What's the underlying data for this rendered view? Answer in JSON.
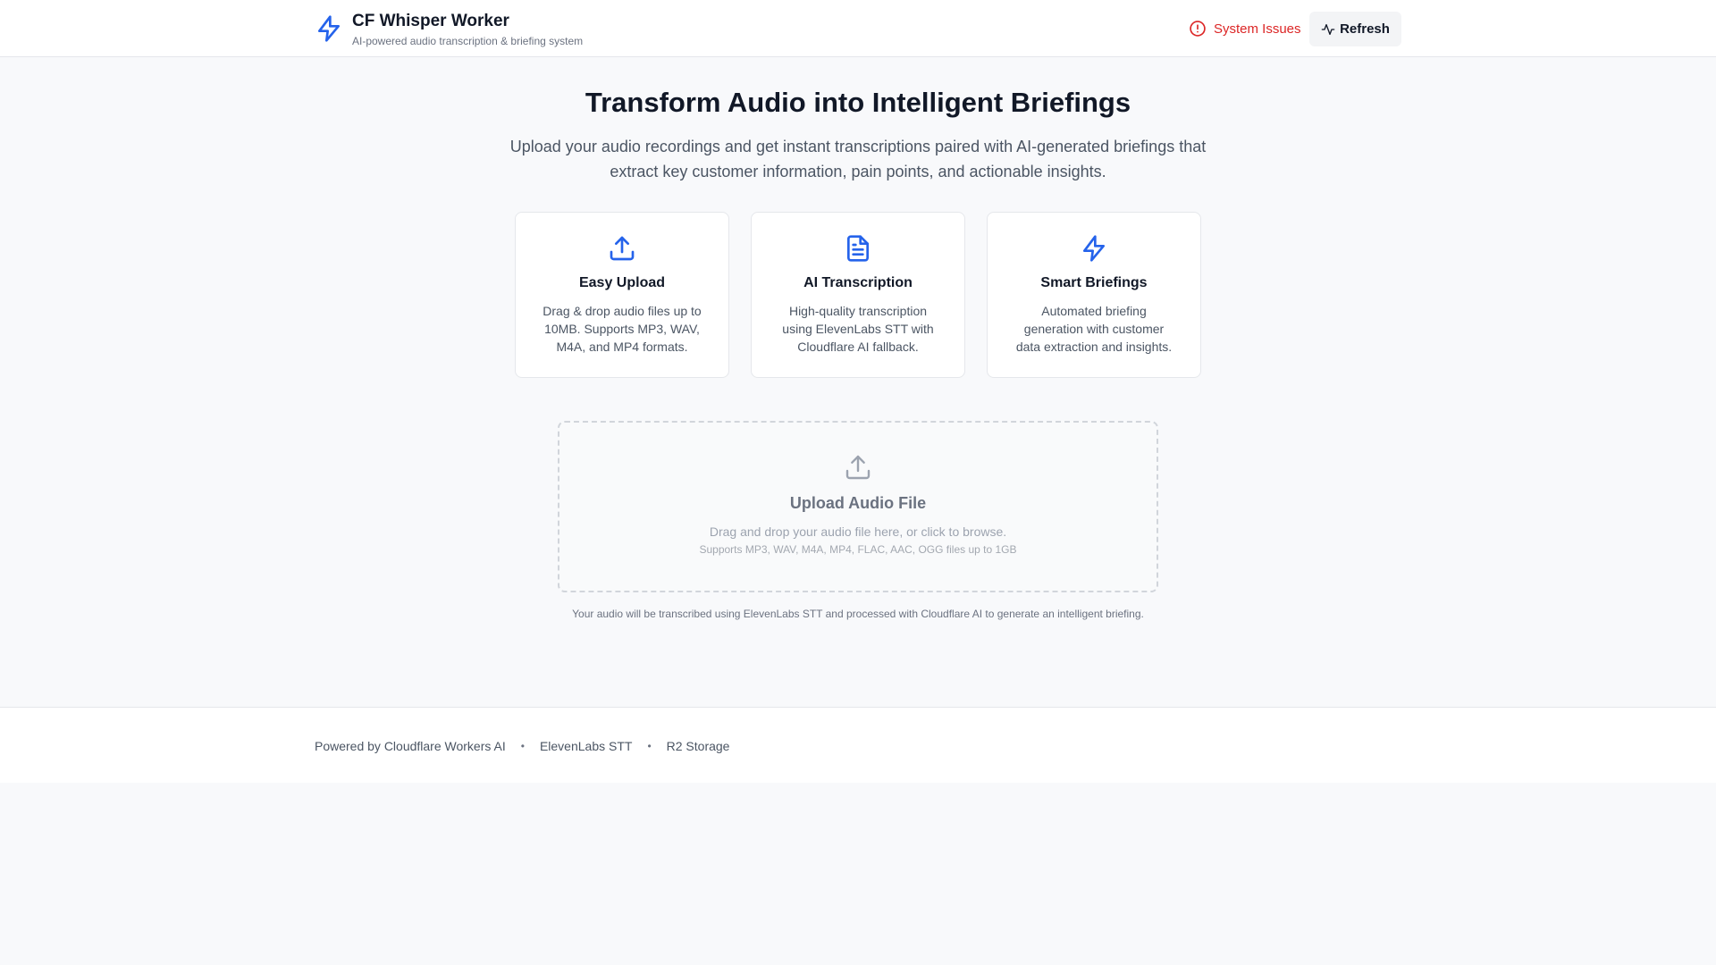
{
  "header": {
    "app_title": "CF Whisper Worker",
    "app_subtitle": "AI-powered audio transcription & briefing system",
    "status_label": "System Issues",
    "refresh_label": "Refresh"
  },
  "hero": {
    "title": "Transform Audio into Intelligent Briefings",
    "description": "Upload your audio recordings and get instant transcriptions paired with AI-generated briefings that extract key customer information, pain points, and actionable insights."
  },
  "features": [
    {
      "icon": "upload-icon",
      "title": "Easy Upload",
      "text": "Drag & drop audio files up to 10MB. Supports MP3, WAV, M4A, and MP4 formats."
    },
    {
      "icon": "file-text-icon",
      "title": "AI Transcription",
      "text": "High-quality transcription using ElevenLabs STT with Cloudflare AI fallback."
    },
    {
      "icon": "zap-icon",
      "title": "Smart Briefings",
      "text": "Automated briefing generation with customer data extraction and insights."
    }
  ],
  "upload": {
    "icon": "upload-icon",
    "title": "Upload Audio File",
    "instructions": "Drag and drop your audio file here, or click to browse.",
    "formats": "Supports MP3, WAV, M4A, MP4, FLAC, AAC, OGG files up to 1GB",
    "note": "Your audio will be transcribed using ElevenLabs STT and processed with Cloudflare AI to generate an intelligent briefing."
  },
  "footer": {
    "items": [
      "Powered by Cloudflare Workers AI",
      "ElevenLabs STT",
      "R2 Storage"
    ],
    "separator": "•"
  },
  "colors": {
    "accent": "#2563eb",
    "error": "#dc2626",
    "background": "#f8f9fb"
  }
}
